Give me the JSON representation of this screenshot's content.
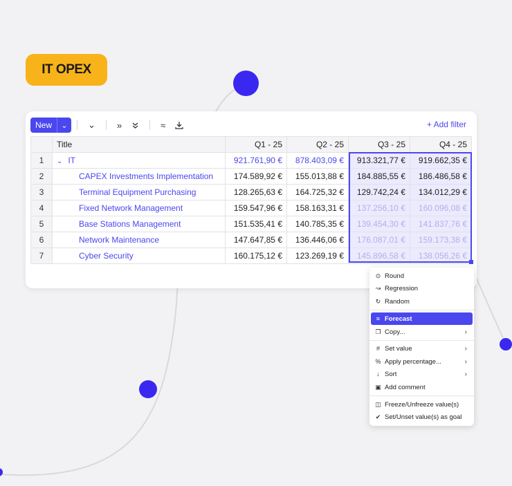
{
  "badge": {
    "label": "IT OPEX"
  },
  "toolbar": {
    "new_label": "New",
    "add_filter_label": "+ Add filter",
    "icons": [
      "chevron-down-icon",
      "double-chevron-right-icon",
      "double-chevron-down-icon",
      "forecast-icon",
      "download-icon"
    ]
  },
  "table": {
    "headers": {
      "title": "Title",
      "q1": "Q1 - 25",
      "q2": "Q2 - 25",
      "q3": "Q3 - 25",
      "q4": "Q4 - 25"
    },
    "rows": [
      {
        "num": "1",
        "title": "IT",
        "q1": "921.761,90 €",
        "q2": "878.403,09 €",
        "q3": "913.321,77 €",
        "q4": "919.662,35 €"
      },
      {
        "num": "2",
        "title": "CAPEX Investments Implementation",
        "q1": "174.589,92 €",
        "q2": "155.013,88 €",
        "q3": "184.885,55 €",
        "q4": "186.486,58 €"
      },
      {
        "num": "3",
        "title": "Terminal Equipment Purchasing",
        "q1": "128.265,63 €",
        "q2": "164.725,32 €",
        "q3": "129.742,24 €",
        "q4": "134.012,29 €"
      },
      {
        "num": "4",
        "title": "Fixed Network Management",
        "q1": "159.547,96 €",
        "q2": "158.163,31 €",
        "q3": "137.256,10 €",
        "q4": "160.096,08 €"
      },
      {
        "num": "5",
        "title": "Base Stations Management",
        "q1": "151.535,41 €",
        "q2": "140.785,35 €",
        "q3": "139.454,30 €",
        "q4": "141.837,76 €"
      },
      {
        "num": "6",
        "title": "Network Maintenance",
        "q1": "147.647,85 €",
        "q2": "136.446,06 €",
        "q3": "176.087,01 €",
        "q4": "159.173,38 €"
      },
      {
        "num": "7",
        "title": "Cyber Security",
        "q1": "160.175,12 €",
        "q2": "123.269,19 €",
        "q3": "145.896,58 €",
        "q4": "138.056,26 €"
      }
    ]
  },
  "context_menu": {
    "items": [
      {
        "label": "Round",
        "icon": "round-icon",
        "submenu": false
      },
      {
        "label": "Regression",
        "icon": "regression-icon",
        "submenu": false
      },
      {
        "label": "Random",
        "icon": "random-icon",
        "submenu": false
      },
      {
        "label": "Forecast",
        "icon": "forecast-icon",
        "submenu": false,
        "active": true
      },
      {
        "label": "Copy...",
        "icon": "copy-icon",
        "submenu": true
      },
      {
        "label": "Set value",
        "icon": "hash-icon",
        "submenu": true
      },
      {
        "label": "Apply percentage...",
        "icon": "percent-icon",
        "submenu": true
      },
      {
        "label": "Sort",
        "icon": "sort-icon",
        "submenu": true
      },
      {
        "label": "Add comment",
        "icon": "comment-icon",
        "submenu": false
      },
      {
        "label": "Freeze/Unfreeze value(s)",
        "icon": "lock-icon",
        "submenu": false
      },
      {
        "label": "Set/Unset value(s) as goal",
        "icon": "goal-icon",
        "submenu": false
      }
    ]
  },
  "colors": {
    "accent": "#4a47ee",
    "badge": "#f8b31a",
    "dot": "#3b28f0",
    "background": "#f2f2f4"
  }
}
